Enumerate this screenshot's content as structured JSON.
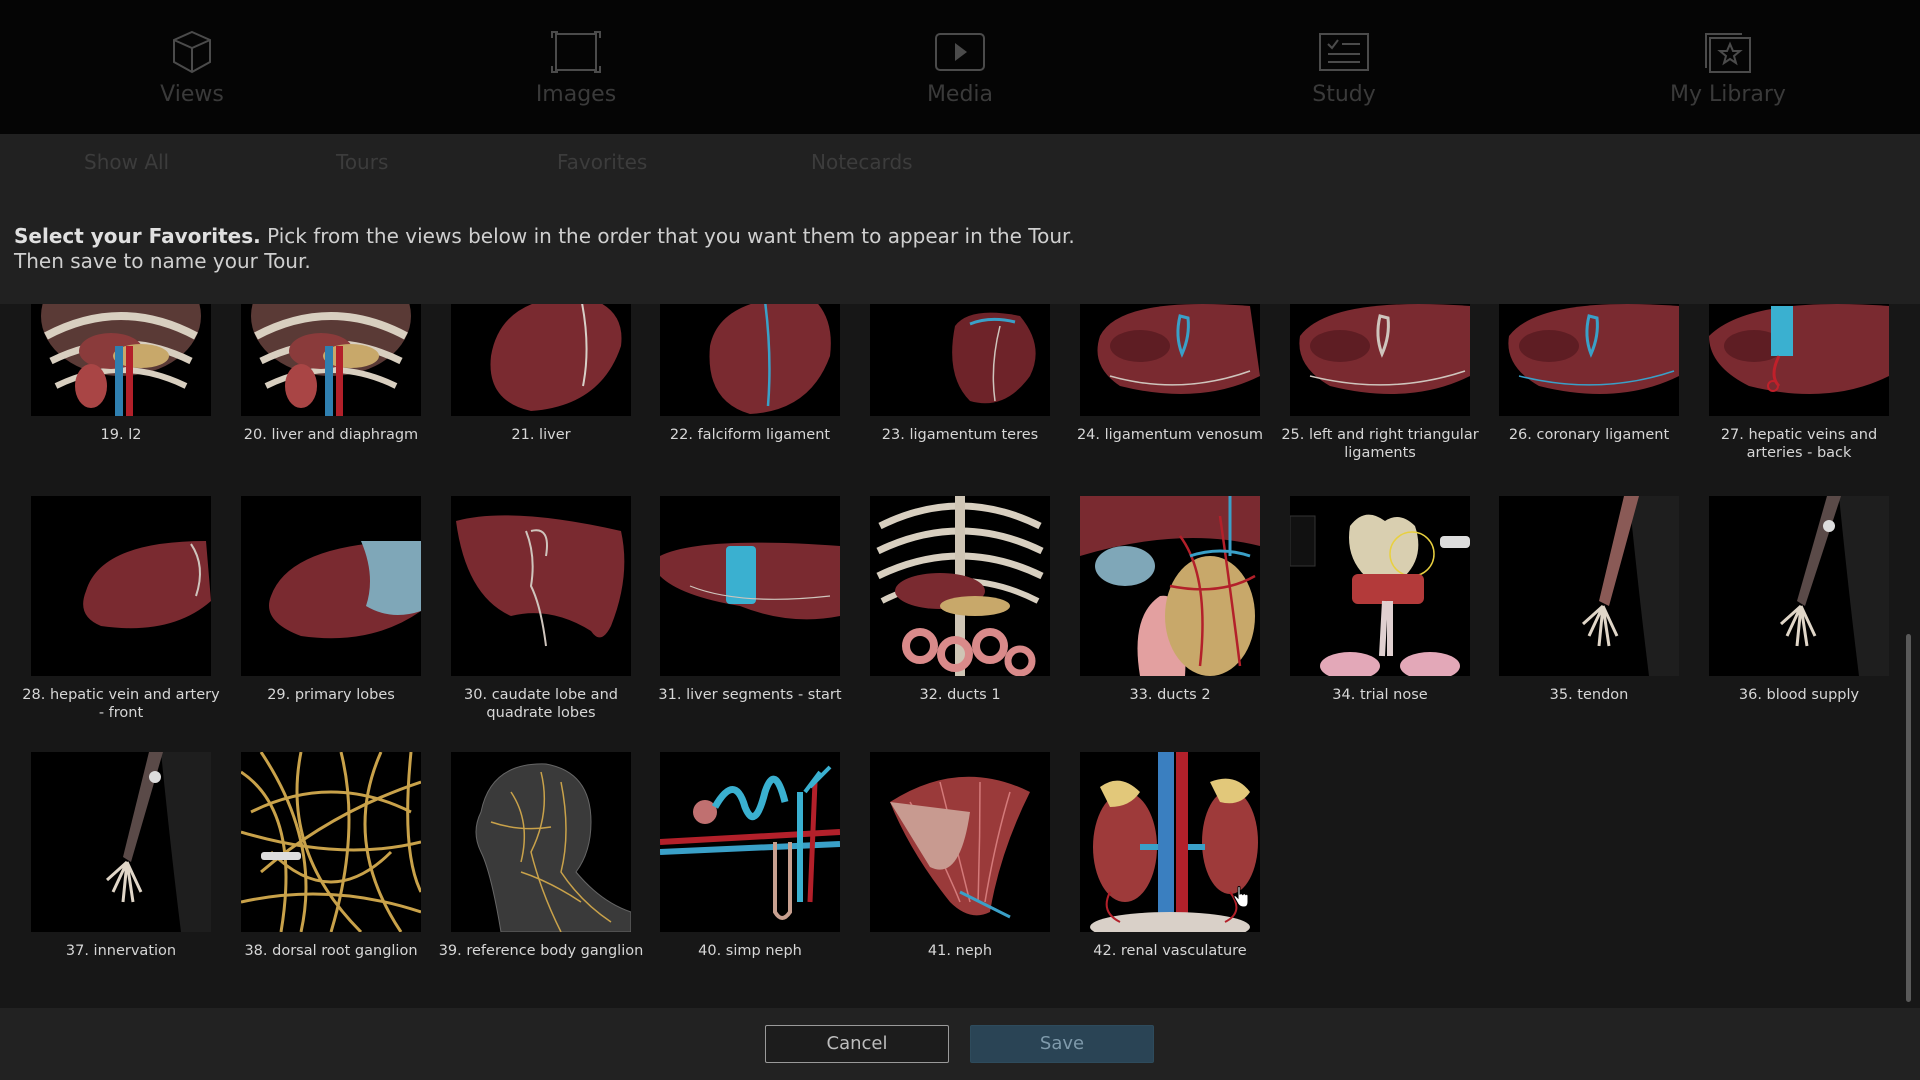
{
  "nav": {
    "tabs": [
      {
        "label": "Views",
        "icon": "cube-icon"
      },
      {
        "label": "Images",
        "icon": "image-frame-icon"
      },
      {
        "label": "Media",
        "icon": "play-icon"
      },
      {
        "label": "Study",
        "icon": "checklist-icon"
      },
      {
        "label": "My Library",
        "icon": "library-star-icon"
      }
    ]
  },
  "subnav": {
    "items": [
      "Show All",
      "Tours",
      "Favorites",
      "Notecards"
    ]
  },
  "instructions": {
    "bold": "Select your Favorites.",
    "line1": " Pick from the views below in the order that you want them to appear in the Tour.",
    "line2": "Then save to name your Tour."
  },
  "views": [
    {
      "label": "19. l2"
    },
    {
      "label": "20. liver and diaphragm"
    },
    {
      "label": "21. liver"
    },
    {
      "label": "22. falciform ligament"
    },
    {
      "label": "23. ligamentum teres"
    },
    {
      "label": "24. ligamentum venosum"
    },
    {
      "label": "25. left and right triangular ligaments"
    },
    {
      "label": "26. coronary ligament"
    },
    {
      "label": "27. hepatic veins and arteries - back"
    },
    {
      "label": "28. hepatic vein and artery - front"
    },
    {
      "label": "29. primary lobes"
    },
    {
      "label": "30. caudate lobe and quadrate lobes"
    },
    {
      "label": "31. liver segments - start"
    },
    {
      "label": "32. ducts 1"
    },
    {
      "label": "33. ducts 2"
    },
    {
      "label": "34. trial nose"
    },
    {
      "label": "35. tendon"
    },
    {
      "label": "36. blood supply"
    },
    {
      "label": "37. innervation"
    },
    {
      "label": "38. dorsal root ganglion"
    },
    {
      "label": "39. reference body ganglion"
    },
    {
      "label": "40. simp neph"
    },
    {
      "label": "41. neph"
    },
    {
      "label": "42. renal vasculature"
    }
  ],
  "footer": {
    "cancel_label": "Cancel",
    "save_label": "Save"
  },
  "colors": {
    "liver": "#7a2a30",
    "vein": "#3aa0c8",
    "artery": "#b3202a",
    "bone": "#d9cfc0",
    "nerve": "#c9a24a"
  }
}
